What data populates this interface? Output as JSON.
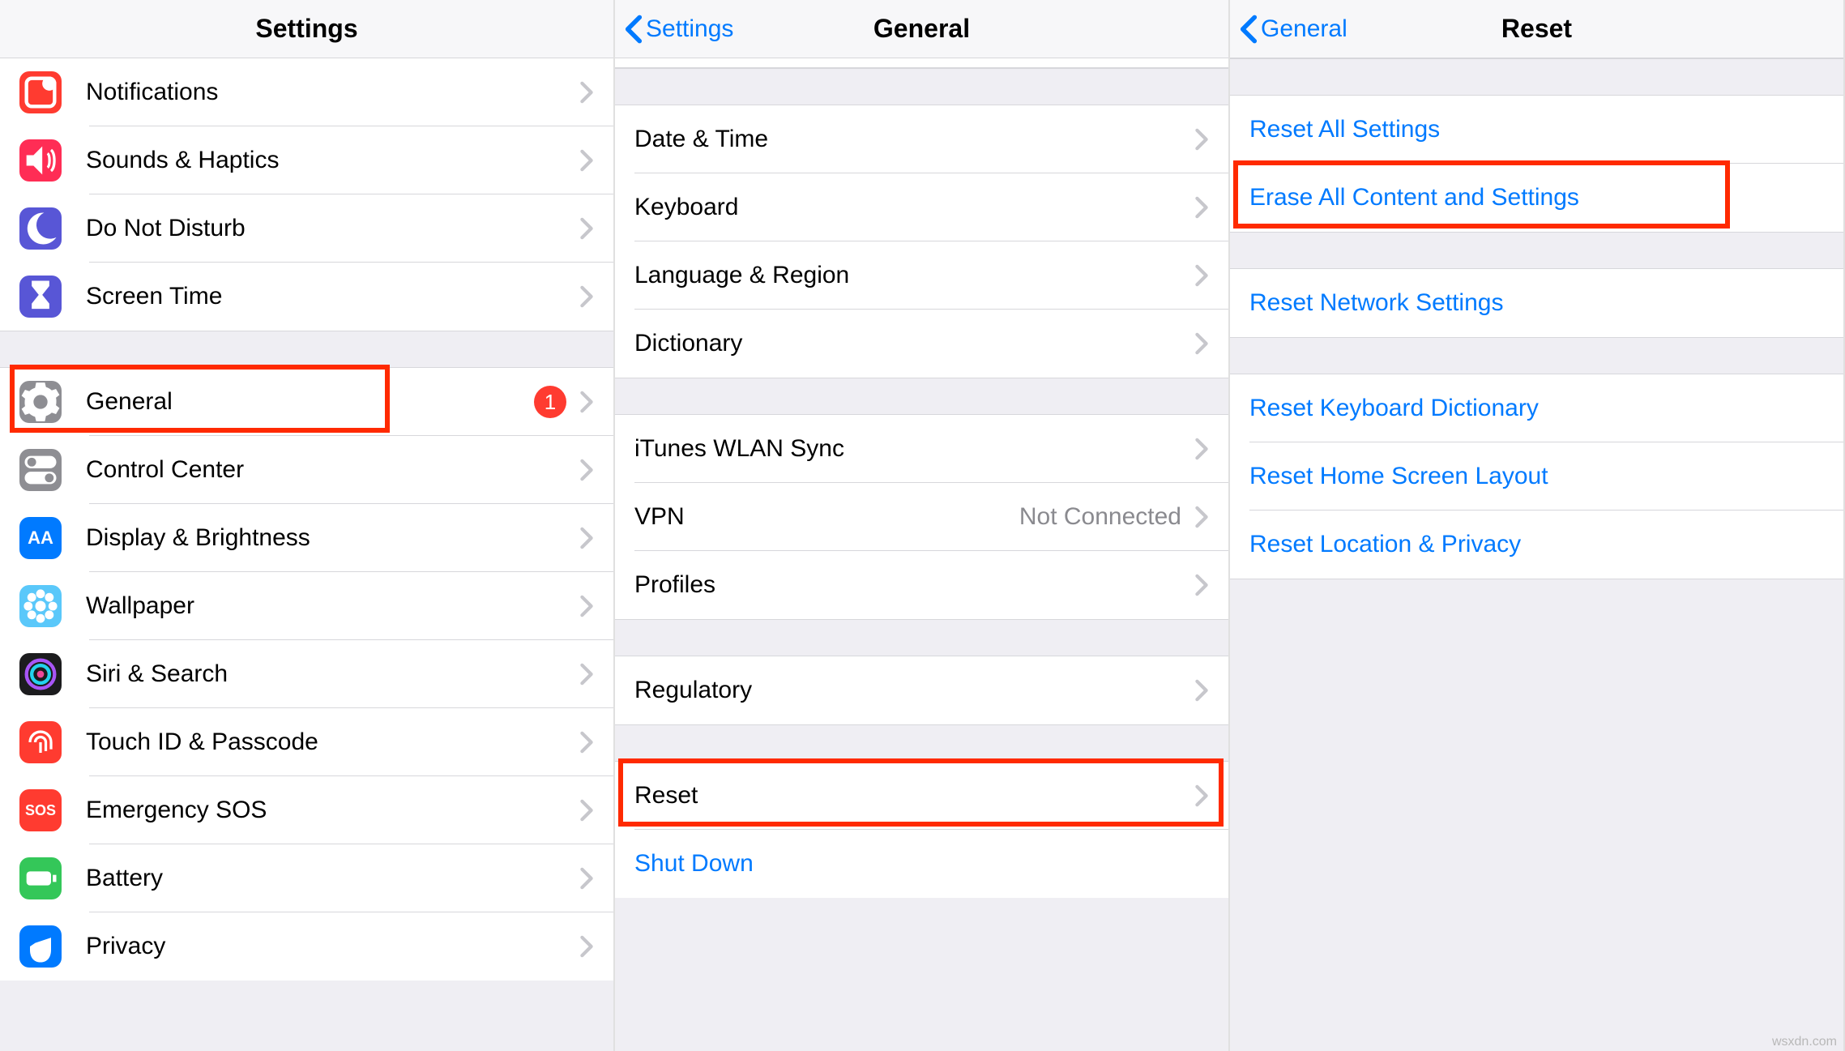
{
  "panel1": {
    "title": "Settings",
    "items_a": [
      {
        "label": "Notifications"
      },
      {
        "label": "Sounds & Haptics"
      },
      {
        "label": "Do Not Disturb"
      },
      {
        "label": "Screen Time"
      }
    ],
    "items_b": [
      {
        "label": "General",
        "badge": "1",
        "highlight": true
      },
      {
        "label": "Control Center"
      },
      {
        "label": "Display & Brightness"
      },
      {
        "label": "Wallpaper"
      },
      {
        "label": "Siri & Search"
      },
      {
        "label": "Touch ID & Passcode"
      },
      {
        "label": "Emergency SOS"
      },
      {
        "label": "Battery"
      },
      {
        "label": "Privacy"
      }
    ]
  },
  "panel2": {
    "back": "Settings",
    "title": "General",
    "group_a": [
      {
        "label": "Date & Time"
      },
      {
        "label": "Keyboard"
      },
      {
        "label": "Language & Region"
      },
      {
        "label": "Dictionary"
      }
    ],
    "group_b": [
      {
        "label": "iTunes WLAN Sync"
      },
      {
        "label": "VPN",
        "value": "Not Connected"
      },
      {
        "label": "Profiles"
      }
    ],
    "group_c": [
      {
        "label": "Regulatory"
      }
    ],
    "group_d": [
      {
        "label": "Reset",
        "highlight": true
      },
      {
        "label": "Shut Down",
        "link": true
      }
    ]
  },
  "panel3": {
    "back": "General",
    "title": "Reset",
    "group_a": [
      {
        "label": "Reset All Settings"
      },
      {
        "label": "Erase All Content and Settings",
        "highlight": true
      }
    ],
    "group_b": [
      {
        "label": "Reset Network Settings"
      }
    ],
    "group_c": [
      {
        "label": "Reset Keyboard Dictionary"
      },
      {
        "label": "Reset Home Screen Layout"
      },
      {
        "label": "Reset Location & Privacy"
      }
    ]
  },
  "watermark": "wsxdn.com"
}
